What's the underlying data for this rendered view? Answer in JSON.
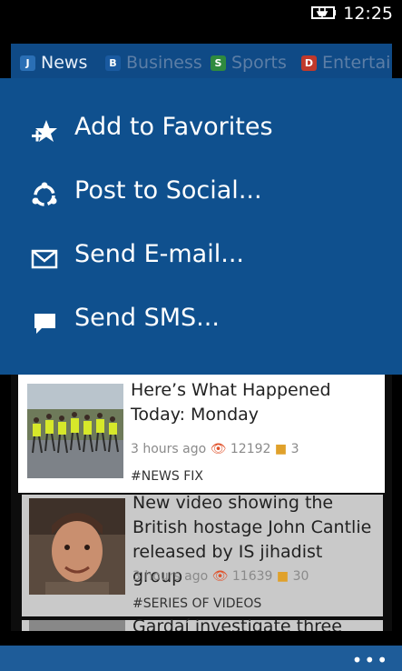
{
  "status": {
    "time": "12:25"
  },
  "tabs": [
    {
      "icon_letter": "J",
      "label": "News",
      "color": "#2a6fb5"
    },
    {
      "icon_letter": "B",
      "label": "Business",
      "color": "#1a5aa0"
    },
    {
      "icon_letter": "S",
      "label": "Sports",
      "color": "#2f8a3e"
    },
    {
      "icon_letter": "D",
      "label": "Entertain",
      "color": "#c0392b"
    }
  ],
  "menu": [
    {
      "label": "Add to Favorites",
      "icon": "favorites-add-icon"
    },
    {
      "label": "Post to Social...",
      "icon": "share-icon"
    },
    {
      "label": "Send E-mail...",
      "icon": "mail-icon"
    },
    {
      "label": "Send SMS...",
      "icon": "sms-icon"
    }
  ],
  "articles": [
    {
      "title": "Here’s What Happened Today: Monday",
      "time": "3 hours ago",
      "views": "12192",
      "comments": "3",
      "tag": "#NEWS FIX"
    },
    {
      "title": "New video showing the British hostage John Cantlie released by IS jihadist group",
      "time": "3 hours ago",
      "views": "11639",
      "comments": "30",
      "tag": "#SERIES OF VIDEOS"
    },
    {
      "title": "Gardaí investigate three"
    }
  ],
  "colors": {
    "menu_bg": "#0f508e",
    "app_bar": "#1e5c99"
  }
}
